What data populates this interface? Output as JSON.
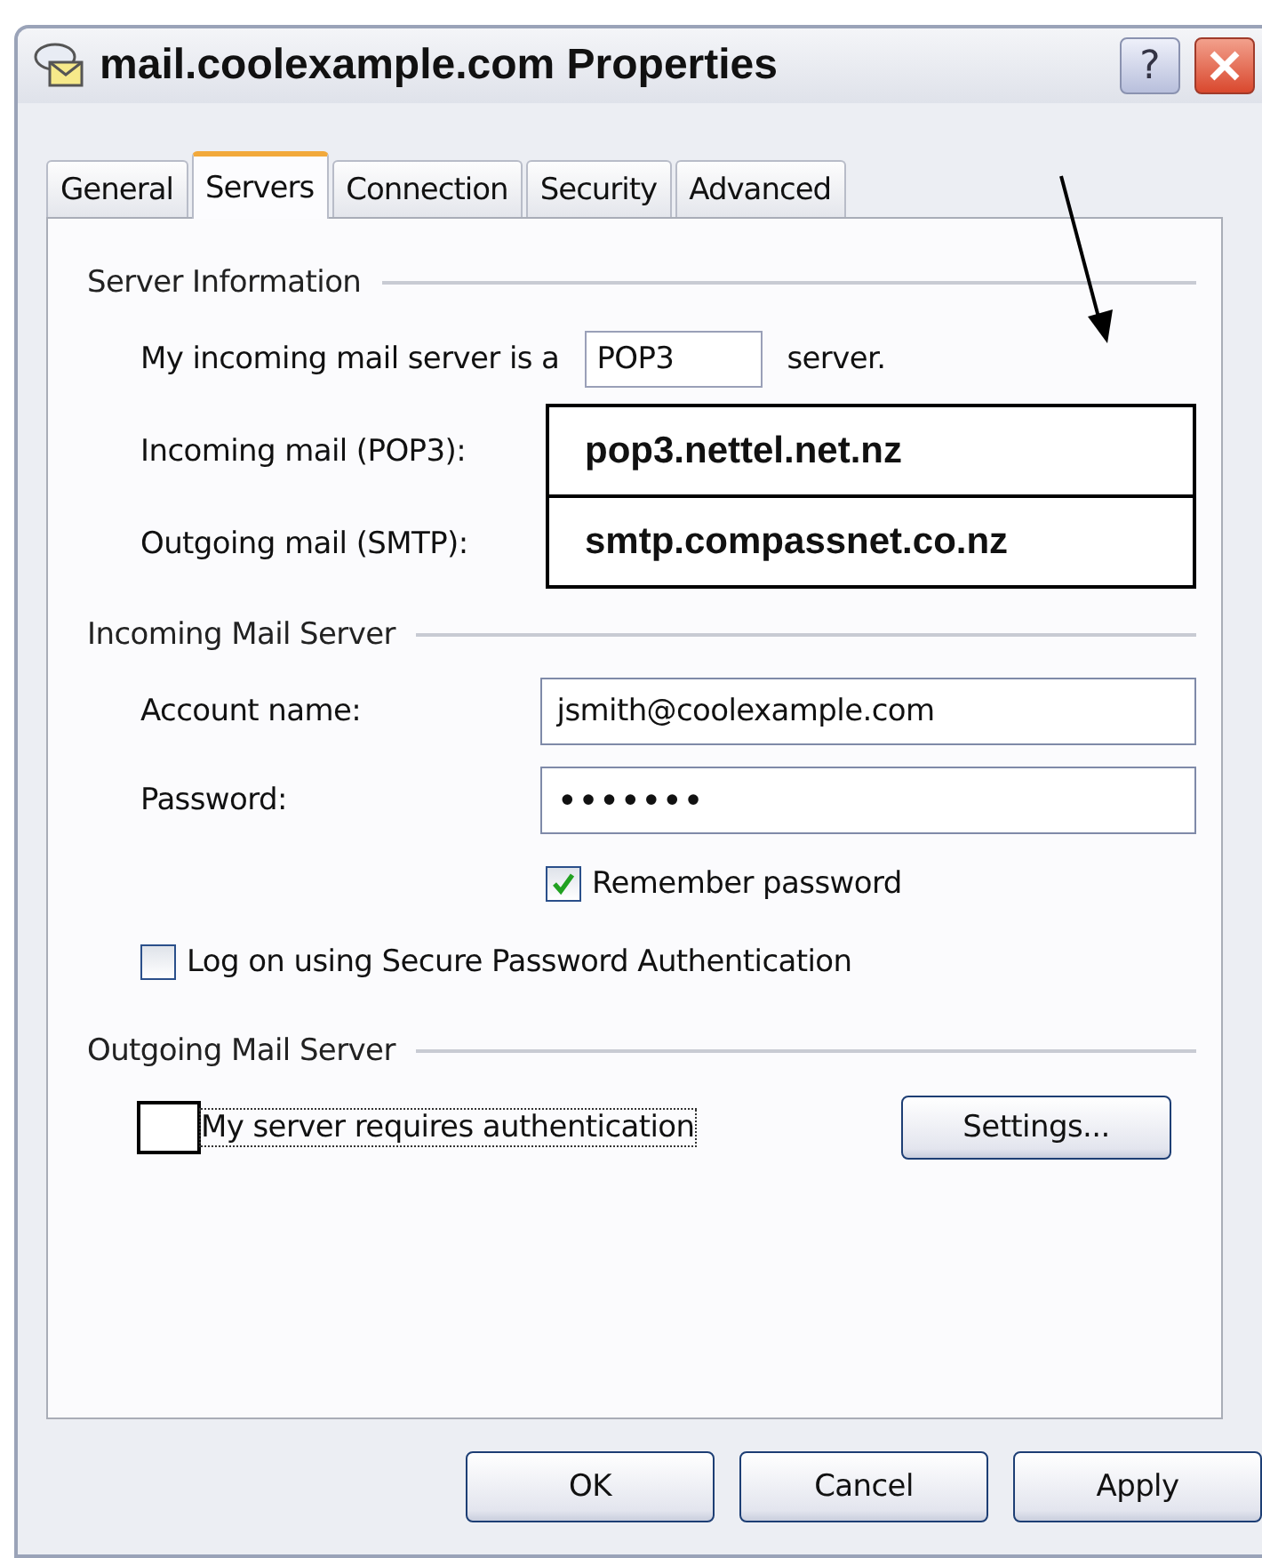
{
  "window": {
    "title": "mail.coolexample.com Properties",
    "help_button": "?"
  },
  "tabs": [
    {
      "label": "General",
      "selected": false
    },
    {
      "label": "Servers",
      "selected": true
    },
    {
      "label": "Connection",
      "selected": false
    },
    {
      "label": "Security",
      "selected": false
    },
    {
      "label": "Advanced",
      "selected": false
    }
  ],
  "server_information": {
    "heading": "Server Information",
    "type_label": "My incoming mail server is a",
    "server_type": "POP3",
    "type_suffix": "server.",
    "fields": [
      {
        "label": "Incoming mail (POP3):",
        "value": "pop3.nettel.net.nz"
      },
      {
        "label": "Outgoing mail (SMTP):",
        "value": "smtp.compassnet.co.nz"
      }
    ]
  },
  "incoming_mail_server": {
    "heading": "Incoming Mail Server",
    "account_label": "Account name:",
    "account_value": "jsmith@coolexample.com",
    "password_label": "Password:",
    "password_value": "•••••••",
    "remember_password": {
      "label": "Remember password",
      "checked": true
    },
    "secure_auth": {
      "label": "Log on using Secure Password Authentication",
      "checked": false
    }
  },
  "outgoing_mail_server": {
    "heading": "Outgoing Mail Server",
    "requires_auth": {
      "label": "My server requires authentication",
      "checked": false
    },
    "settings_button": "Settings..."
  },
  "buttons": [
    "OK",
    "Cancel",
    "Apply"
  ]
}
